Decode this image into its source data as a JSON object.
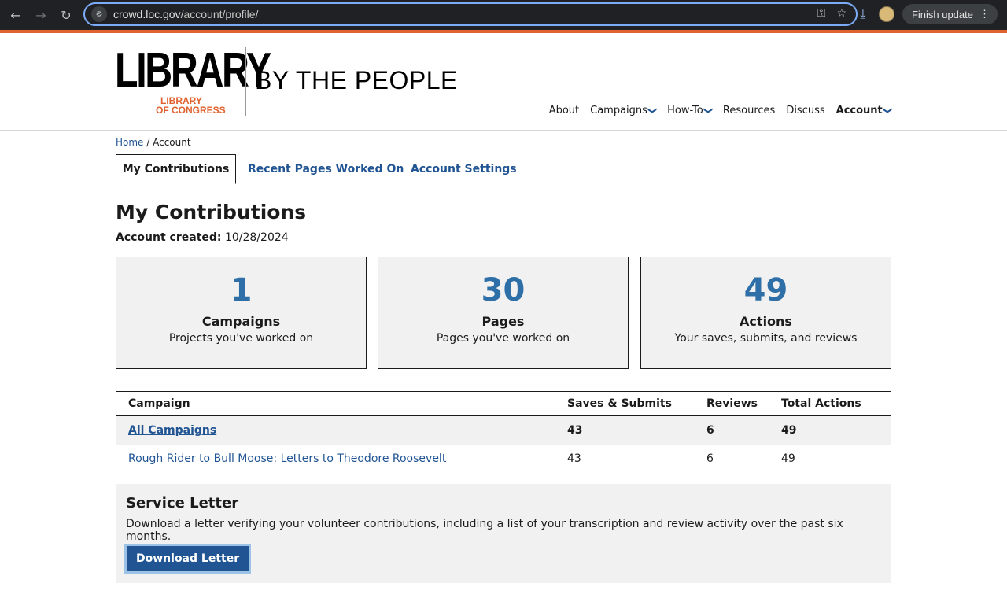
{
  "browser": {
    "url_host": "crowd.loc.gov",
    "url_path": "/account/profile/",
    "finish_update": "Finish update",
    "icons": [
      "back-icon",
      "forward-icon",
      "reload-icon",
      "site-info-icon",
      "password-key-icon",
      "bookmark-star-icon",
      "download-icon",
      "profile-avatar",
      "menu-kebab-icon"
    ]
  },
  "header": {
    "logo_word": "LIBRARY",
    "logo_loc_line1": "LIBRARY",
    "logo_loc_line2": "OF CONGRESS",
    "tagline": "BY THE PEOPLE",
    "nav": {
      "about": "About",
      "campaigns": "Campaigns",
      "howto": "How-To",
      "resources": "Resources",
      "discuss": "Discuss",
      "account": "Account"
    }
  },
  "breadcrumb": {
    "home": "Home",
    "sep": " / ",
    "current": "Account"
  },
  "tabs": [
    "My Contributions",
    "Recent Pages Worked On",
    "Account Settings"
  ],
  "main": {
    "title": "My Contributions",
    "created_label": "Account created:",
    "created_value": "10/28/2024"
  },
  "stats": [
    {
      "value": "1",
      "label": "Campaigns",
      "desc": "Projects you've worked on"
    },
    {
      "value": "30",
      "label": "Pages",
      "desc": "Pages you've worked on"
    },
    {
      "value": "49",
      "label": "Actions",
      "desc": "Your saves, submits, and reviews"
    }
  ],
  "table": {
    "headers": [
      "Campaign",
      "Saves & Submits",
      "Reviews",
      "Total Actions"
    ],
    "rows": [
      {
        "campaign": "All Campaigns",
        "saves": "43",
        "reviews": "6",
        "total": "49"
      },
      {
        "campaign": "Rough Rider to Bull Moose: Letters to Theodore Roosevelt",
        "saves": "43",
        "reviews": "6",
        "total": "49"
      }
    ]
  },
  "service_letter": {
    "title": "Service Letter",
    "text": "Download a letter verifying your volunteer contributions, including a list of your transcription and review activity over the past six months.",
    "button": "Download Letter"
  },
  "colors": {
    "accent": "#e0622e",
    "link": "#205493",
    "stat_number": "#2e6fa7"
  }
}
